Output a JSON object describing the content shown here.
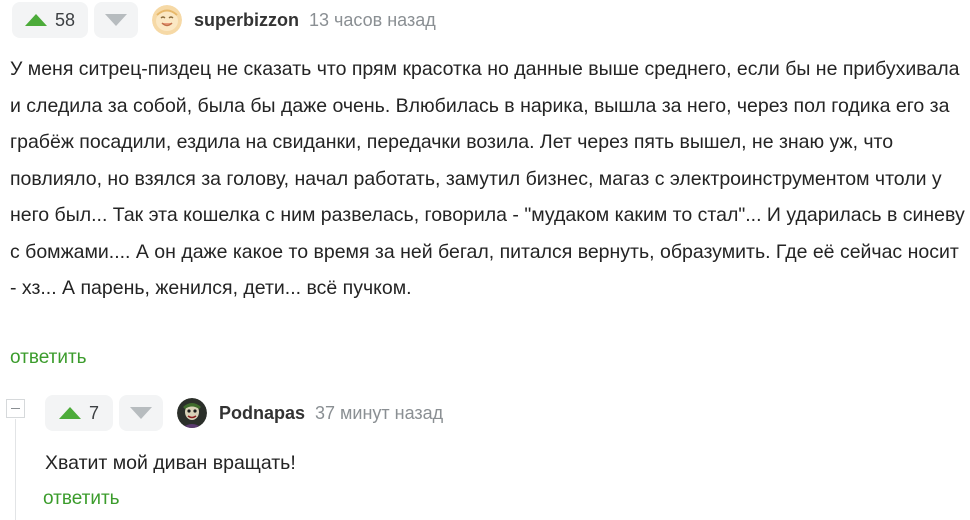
{
  "comments": [
    {
      "votes_up": "58",
      "author": "superbizzon",
      "time": "13 часов назад",
      "text": "У меня ситрец-пиздец не сказать что прям красотка но данные выше среднего, если бы не прибухивала и следила за собой, была бы даже очень. Влюбилась в нарика, вышла за него, через пол годика его за грабёж посадили, ездила на свиданки, передачки возила. Лет через пять вышел, не знаю уж, что повлияло, но взялся за голову, начал работать, замутил бизнес, магаз с электроинструментом чтоли у него был... Так эта кошелка с ним развелась, говорила - \"мудаком каким то стал\"... И ударилась в синеву с бомжами.... А он даже какое то время за ней бегал, питался вернуть, образумить. Где её сейчас носит - хз... А парень, женился, дети... всё пучком.",
      "reply_label": "ответить",
      "avatar_icon": "smiling-face-avatar-icon"
    },
    {
      "votes_up": "7",
      "author": "Podnapas",
      "time": "37 минут назад",
      "text": "Хватит мой диван вращать!",
      "reply_label": "ответить",
      "avatar_icon": "dark-figure-avatar-icon"
    }
  ],
  "colors": {
    "upvote": "#4cab3a",
    "downvote": "#b7bcbf",
    "reply_link": "#3b9c2c",
    "vote_bg": "#f3f4f5",
    "time": "#8a8f93"
  }
}
